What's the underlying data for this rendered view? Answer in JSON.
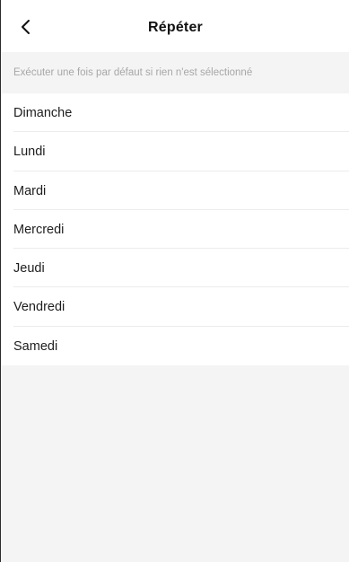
{
  "header": {
    "back_icon": "chevron-left-icon",
    "title": "Répéter"
  },
  "hint": {
    "text": "Exécuter une fois par défaut si rien n'est sélectionné"
  },
  "days": [
    {
      "label": "Dimanche"
    },
    {
      "label": "Lundi"
    },
    {
      "label": "Mardi"
    },
    {
      "label": "Mercredi"
    },
    {
      "label": "Jeudi"
    },
    {
      "label": "Vendredi"
    },
    {
      "label": "Samedi"
    }
  ],
  "colors": {
    "background": "#f4f4f4",
    "surface": "#ffffff",
    "text_primary": "#1d1d1d",
    "text_hint": "#a7a7a7",
    "divider": "#ececec"
  }
}
